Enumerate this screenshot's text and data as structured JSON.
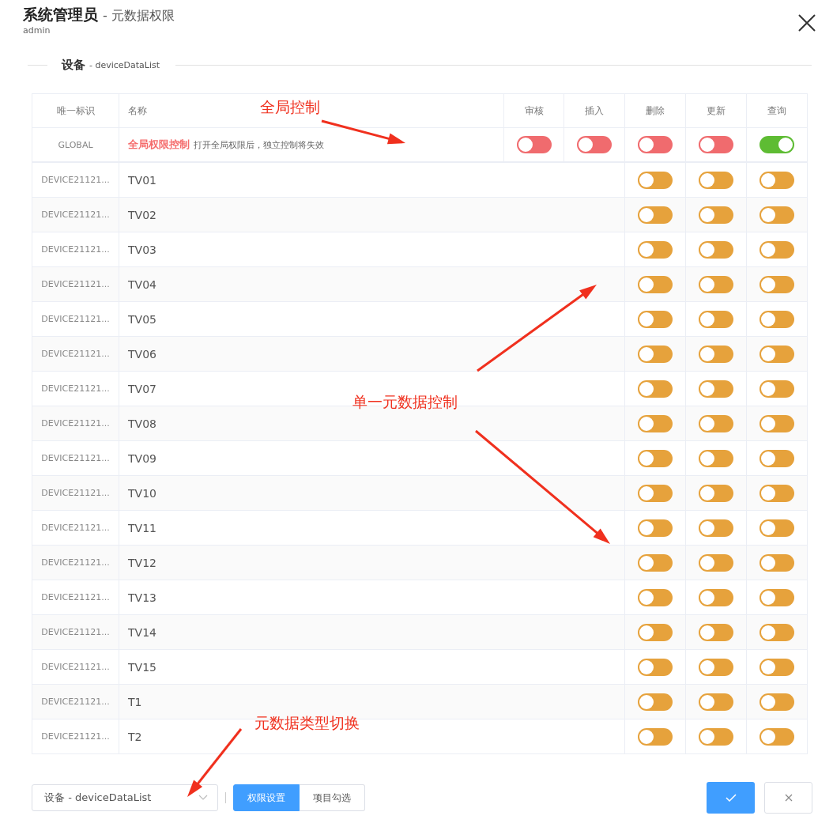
{
  "header": {
    "title": "系统管理员",
    "subtitle": "- 元数据权限",
    "user": "admin"
  },
  "section": {
    "title": "设备",
    "code": "- deviceDataList"
  },
  "columns": [
    "唯一标识",
    "名称",
    "审核",
    "插入",
    "删除",
    "更新",
    "查询"
  ],
  "global": {
    "id": "GLOBAL",
    "name": "全局权限控制",
    "hint": "打开全局权限后，独立控制将失效",
    "toggles": [
      {
        "on": false
      },
      {
        "on": false
      },
      {
        "on": false
      },
      {
        "on": false
      },
      {
        "on": true
      }
    ]
  },
  "rows": [
    {
      "id": "DEVICE21121...",
      "name": "TV01",
      "toggles": [
        {
          "on": false
        },
        {
          "on": false
        },
        {
          "on": false
        }
      ]
    },
    {
      "id": "DEVICE21121...",
      "name": "TV02",
      "toggles": [
        {
          "on": false
        },
        {
          "on": false
        },
        {
          "on": false
        }
      ]
    },
    {
      "id": "DEVICE21121...",
      "name": "TV03",
      "toggles": [
        {
          "on": false
        },
        {
          "on": false
        },
        {
          "on": false
        }
      ]
    },
    {
      "id": "DEVICE21121...",
      "name": "TV04",
      "toggles": [
        {
          "on": false
        },
        {
          "on": false
        },
        {
          "on": false
        }
      ]
    },
    {
      "id": "DEVICE21121...",
      "name": "TV05",
      "toggles": [
        {
          "on": false
        },
        {
          "on": false
        },
        {
          "on": false
        }
      ]
    },
    {
      "id": "DEVICE21121...",
      "name": "TV06",
      "toggles": [
        {
          "on": false
        },
        {
          "on": false
        },
        {
          "on": false
        }
      ]
    },
    {
      "id": "DEVICE21121...",
      "name": "TV07",
      "toggles": [
        {
          "on": false
        },
        {
          "on": false
        },
        {
          "on": false
        }
      ]
    },
    {
      "id": "DEVICE21121...",
      "name": "TV08",
      "toggles": [
        {
          "on": false
        },
        {
          "on": false
        },
        {
          "on": false
        }
      ]
    },
    {
      "id": "DEVICE21121...",
      "name": "TV09",
      "toggles": [
        {
          "on": false
        },
        {
          "on": false
        },
        {
          "on": false
        }
      ]
    },
    {
      "id": "DEVICE21121...",
      "name": "TV10",
      "toggles": [
        {
          "on": false
        },
        {
          "on": false
        },
        {
          "on": false
        }
      ]
    },
    {
      "id": "DEVICE21121...",
      "name": "TV11",
      "toggles": [
        {
          "on": false
        },
        {
          "on": false
        },
        {
          "on": false
        }
      ]
    },
    {
      "id": "DEVICE21121...",
      "name": "TV12",
      "toggles": [
        {
          "on": false
        },
        {
          "on": false
        },
        {
          "on": false
        }
      ]
    },
    {
      "id": "DEVICE21121...",
      "name": "TV13",
      "toggles": [
        {
          "on": false
        },
        {
          "on": false
        },
        {
          "on": false
        }
      ]
    },
    {
      "id": "DEVICE21121...",
      "name": "TV14",
      "toggles": [
        {
          "on": false
        },
        {
          "on": false
        },
        {
          "on": false
        }
      ]
    },
    {
      "id": "DEVICE21121...",
      "name": "TV15",
      "toggles": [
        {
          "on": false
        },
        {
          "on": false
        },
        {
          "on": false
        }
      ]
    },
    {
      "id": "DEVICE21121...",
      "name": "T1",
      "toggles": [
        {
          "on": false
        },
        {
          "on": false
        },
        {
          "on": false
        }
      ]
    },
    {
      "id": "DEVICE21121...",
      "name": "T2",
      "toggles": [
        {
          "on": false
        },
        {
          "on": false
        },
        {
          "on": false
        }
      ]
    }
  ],
  "footer": {
    "type_select": {
      "value": "设备 - deviceDataList"
    },
    "modes": [
      {
        "label": "权限设置",
        "selected": true
      },
      {
        "label": "项目勾选",
        "selected": false
      }
    ]
  },
  "annotations": [
    {
      "text": "全局控制"
    },
    {
      "text": "单一元数据控制"
    },
    {
      "text": "元数据类型切换"
    }
  ]
}
